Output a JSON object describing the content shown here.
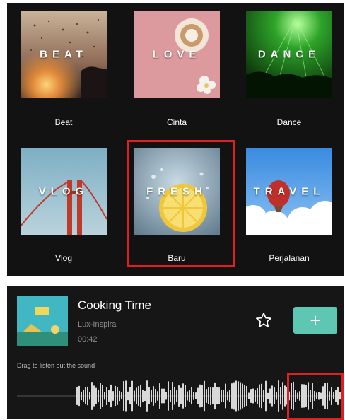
{
  "templates": [
    {
      "overlay": "BEAT",
      "label": "Beat"
    },
    {
      "overlay": "LOVE",
      "label": "Cinta"
    },
    {
      "overlay": "DANCE",
      "label": "Dance"
    },
    {
      "overlay": "VLOG",
      "label": "Vlog"
    },
    {
      "overlay": "FRESH",
      "label": "Baru"
    },
    {
      "overlay": "TRAVEL",
      "label": "Perjalanan"
    }
  ],
  "track": {
    "title": "Cooking Time",
    "artist": "Lux-Inspira",
    "duration": "00:42",
    "hint": "Drag to listen out the sound",
    "add_label": "+"
  },
  "colors": {
    "highlight": "#e02020",
    "accent": "#5ec7b3",
    "panel": "#121212"
  },
  "icons": {
    "favorite": "star-outline-icon",
    "add": "plus-icon"
  }
}
